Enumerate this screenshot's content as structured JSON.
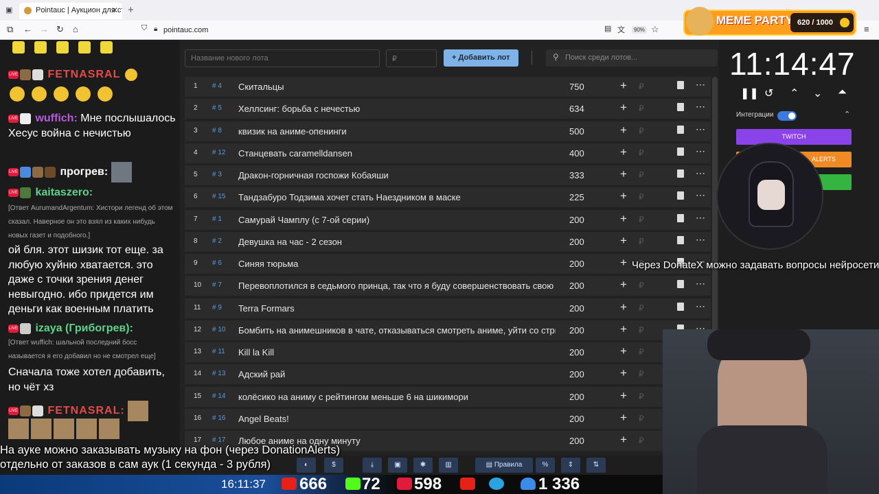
{
  "browser": {
    "tab_title": "Pointauc | Аукцион для стримеров",
    "url": "pointauc.com",
    "zoom": "90%"
  },
  "chat": {
    "messages": [
      {
        "nick": "FETNASRAL",
        "nick_color": "#e34b4b"
      },
      {
        "nick": "wuffich:",
        "nick_color": "#b85adc",
        "text": "Мне послышалось Хесус война с нечистью"
      },
      {
        "nick": "прогрев:",
        "nick_color": "#ffffff"
      },
      {
        "nick": "kaitaszero:",
        "nick_color": "#5fd38a"
      },
      {
        "reply": "[Ответ AurumandArgentum: Хистори легенд об этом сказал. Наверное он это взял из каких нибудь новых газет и подобного.]"
      },
      {
        "text": "ой бля. этот шизик тот еще. за любую хуйню хватается. это даже с точки зрения денег невыгодно. ибо придется им деньги как военным платить"
      },
      {
        "nick": "izaya (Грибогрев):",
        "nick_color": "#5fd38a"
      },
      {
        "reply": "[Ответ wuffich: шальной последний босс называется я его добавил но не смотрел еще]"
      },
      {
        "text": "Сначала тоже хотел добавить, но чёт хз"
      },
      {
        "nick": "FETNASRAL:",
        "nick_color": "#e34b4b"
      }
    ]
  },
  "auction": {
    "new_lot_placeholder": "Название нового лота",
    "amount_placeholder": "₽",
    "add_button": "Добавить лот",
    "search_placeholder": "Поиск среди лотов...",
    "currency": "₽",
    "lots": [
      {
        "n": "1",
        "id": "# 4",
        "name": "Скитальцы",
        "amount": "750"
      },
      {
        "n": "2",
        "id": "# 5",
        "name": "Хеллсинг: борьба с нечестью",
        "amount": "634"
      },
      {
        "n": "3",
        "id": "# 8",
        "name": "квизик на аниме-опенинги",
        "amount": "500"
      },
      {
        "n": "4",
        "id": "# 12",
        "name": "Станцевать caramelldansen",
        "amount": "400"
      },
      {
        "n": "5",
        "id": "# 3",
        "name": "Дракон-горничная госпожи Кобаяши",
        "amount": "333"
      },
      {
        "n": "6",
        "id": "# 15",
        "name": "Тандзабуро Тодзима хочет стать Наездником в маске",
        "amount": "225"
      },
      {
        "n": "7",
        "id": "# 1",
        "name": "Самурай Чамплу (с 7-ой серии)",
        "amount": "200"
      },
      {
        "n": "8",
        "id": "# 2",
        "name": "Девушка на час - 2 сезон",
        "amount": "200"
      },
      {
        "n": "9",
        "id": "# 6",
        "name": "Синяя тюрьма",
        "amount": "200"
      },
      {
        "n": "10",
        "id": "# 7",
        "name": "Перевоплотился в седьмого принца, так что я буду совершенствовать свою м",
        "amount": "200"
      },
      {
        "n": "11",
        "id": "# 9",
        "name": "Terra Formars",
        "amount": "200"
      },
      {
        "n": "12",
        "id": "# 10",
        "name": "Бомбить на анимешников в чате, отказываться смотреть аниме, уйти со стри",
        "amount": "200"
      },
      {
        "n": "13",
        "id": "# 11",
        "name": "Kill la Kill",
        "amount": "200"
      },
      {
        "n": "14",
        "id": "# 13",
        "name": "Адский рай",
        "amount": "200"
      },
      {
        "n": "15",
        "id": "# 14",
        "name": "колёсико на аниму с рейтингом меньше 6 на шикимори",
        "amount": "200"
      },
      {
        "n": "16",
        "id": "# 16",
        "name": "Angel Beats!",
        "amount": "200"
      },
      {
        "n": "17",
        "id": "# 17",
        "name": "Любое аниме на одну минуту",
        "amount": "200"
      }
    ]
  },
  "timer": {
    "value": "11:14:47"
  },
  "integrations": {
    "label": "Интеграции",
    "twitch": "TWITCH",
    "alerts": "ALERTS"
  },
  "meme_party": {
    "title": "MEME PARTY",
    "counter": "620 / 1000"
  },
  "overlay": {
    "ticker": "Через DonateX можно задавать вопросы нейросети",
    "note_line1": "На ауке можно заказывать музыку на фон (через DonationAlerts)",
    "note_line2": "отдельно от заказов в сам аук (1 секунда - 3 рубля)"
  },
  "toolbar": {
    "rules": "Правила",
    "percent": "%",
    "dollar": "$"
  },
  "stats": {
    "clock": "16:11:37",
    "youtube": "666",
    "kick": "72",
    "vkplay": "598",
    "viewers": "1 336"
  }
}
